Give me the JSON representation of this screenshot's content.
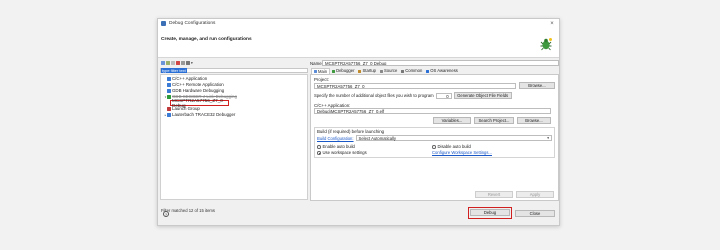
{
  "window": {
    "title": "Debug Configurations",
    "banner_title": "Create, manage, and run configurations"
  },
  "left": {
    "filter_text": "type filter text",
    "tree": [
      {
        "label": "C/C++ Application",
        "color": "#3a7bd5"
      },
      {
        "label": "C/C++ Remote Application",
        "color": "#3a7bd5"
      },
      {
        "label": "GDB Hardware Debugging",
        "color": "#3a7bd5"
      },
      {
        "label": "GDB SEGGER J-Link Debugging",
        "color": "#2b9b3a"
      },
      {
        "label": "MCSPTR2A57756_Z7_0 Debug",
        "color": "#2b9b3a"
      },
      {
        "label": "Launch Group",
        "color": "#c03a3a"
      },
      {
        "label": "Lauterbach TRACE32 Debugger",
        "color": "#3a7bd5"
      }
    ],
    "status": "Filter matched 12 of 15 items"
  },
  "right": {
    "name_label": "Name:",
    "name_value": "MCSPTR2A57756_Z7_0 Debug",
    "tabs": [
      "Main",
      "Debugger",
      "Startup",
      "Source",
      "Common",
      "OS Awareness"
    ],
    "project_label": "Project:",
    "project_value": "MCSPTR2A57756_Z7_0",
    "browse_label": "Browse...",
    "additional_files_text": "Specify the number of additional object files you wish to program",
    "additional_files_value": "0",
    "generate_button": "Generate Object File Fields",
    "app_label": "C/C++ Application:",
    "app_value": "Debug\\MCSPTR2A57756_Z7_0.elf",
    "variables_button": "Variables...",
    "search_project_button": "Search Project...",
    "browse2_label": "Browse...",
    "build_label": "Build (if required) before launching",
    "build_config_link": "Build Configuration:",
    "build_config_value": "Select Automatically",
    "enable_auto_build": "Enable auto build",
    "disable_auto_build": "Disable auto build",
    "use_workspace": "Use workspace settings",
    "configure_link": "Configure Workspace Settings...",
    "revert_button": "Revert",
    "apply_button": "Apply"
  },
  "footer": {
    "help_icon": "?",
    "debug_button": "Debug",
    "close_button": "Close"
  },
  "colors": {
    "highlight_red": "#d02020",
    "selection_blue": "#2a6fd6"
  }
}
